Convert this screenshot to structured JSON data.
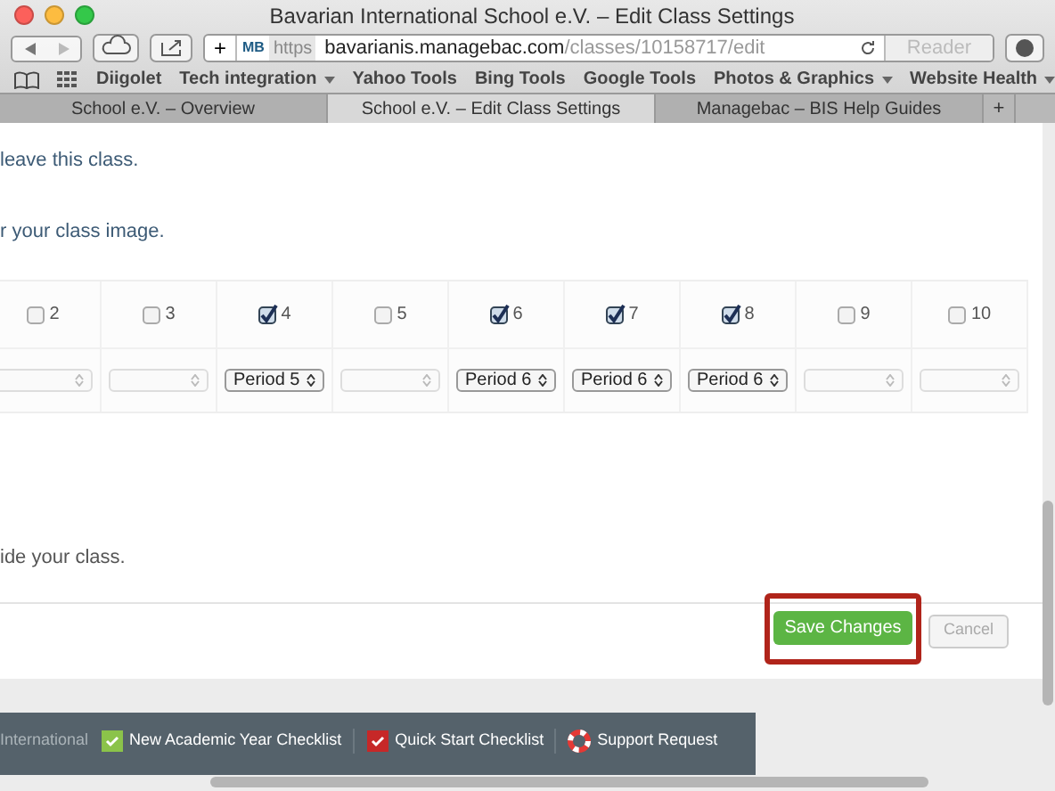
{
  "window": {
    "title": "Bavarian International School e.V. – Edit Class Settings"
  },
  "toolbar": {
    "site_badge": "MB",
    "scheme": "https",
    "host": "bavarianis.managebac.com",
    "path": "/classes/10158717/edit",
    "reader": "Reader",
    "new_tab": "+"
  },
  "bookmarks": [
    {
      "label": "Diigolet",
      "menu": false
    },
    {
      "label": "Tech integration",
      "menu": true
    },
    {
      "label": "Yahoo Tools",
      "menu": false
    },
    {
      "label": "Bing Tools",
      "menu": false
    },
    {
      "label": "Google Tools",
      "menu": false
    },
    {
      "label": "Photos & Graphics",
      "menu": true
    },
    {
      "label": "Website Health",
      "menu": true
    }
  ],
  "tabs": [
    {
      "label": "School e.V. – Overview",
      "selected": false
    },
    {
      "label": "School e.V. – Edit Class Settings",
      "selected": true
    },
    {
      "label": "Managebac – BIS Help Guides",
      "selected": false
    }
  ],
  "content": {
    "line_1": "leave this class.",
    "line_2": "r your class image.",
    "line_3": "ide your class."
  },
  "periods": [
    {
      "label": "2",
      "checked": false
    },
    {
      "label": "3",
      "checked": false
    },
    {
      "label": "4",
      "checked": true,
      "period": "Period 5"
    },
    {
      "label": "5",
      "checked": false
    },
    {
      "label": "6",
      "checked": true,
      "period": "Period 6"
    },
    {
      "label": "7",
      "checked": true,
      "period": "Period 6"
    },
    {
      "label": "8",
      "checked": true,
      "period": "Period 6"
    },
    {
      "label": "9",
      "checked": false
    },
    {
      "label": "10",
      "checked": false
    }
  ],
  "actions": {
    "save": "Save Changes",
    "cancel": "Cancel"
  },
  "footer": {
    "cut_text": "International",
    "links": [
      "New Academic Year Checklist",
      "Quick Start Checklist",
      "Support Request"
    ]
  }
}
